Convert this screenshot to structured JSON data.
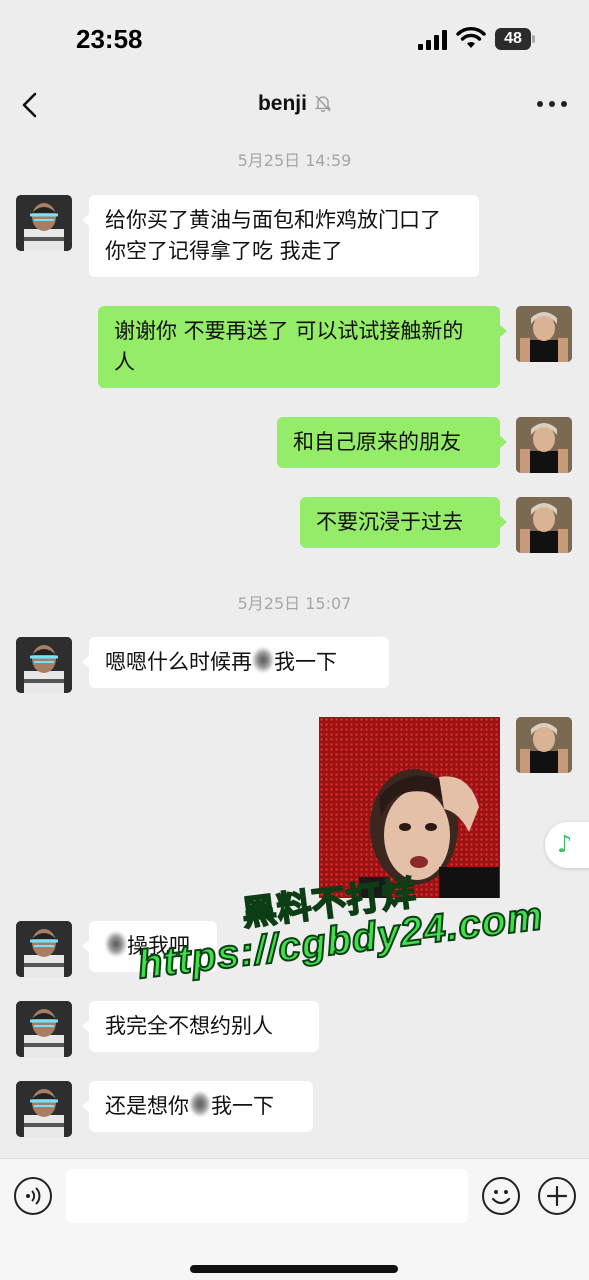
{
  "status_bar": {
    "time": "23:58",
    "battery": "48"
  },
  "header": {
    "title": "benji",
    "back_icon": "chevron-left-icon",
    "mute_icon": "bell-slash-icon",
    "more_icon": "ellipsis-icon"
  },
  "timestamps": [
    "5月25日 14:59",
    "5月25日 15:07"
  ],
  "messages": [
    {
      "side": "in",
      "text": "给你买了黄油与面包和炸鸡放门口了 你空了记得拿了吃 我走了"
    },
    {
      "side": "out",
      "text": "谢谢你 不要再送了 可以试试接触新的人"
    },
    {
      "side": "out",
      "text": "和自己原来的朋友"
    },
    {
      "side": "out",
      "text": "不要沉浸于过去"
    },
    {
      "side": "in",
      "text_before": "嗯嗯什么时候再",
      "text_after": "我一下"
    },
    {
      "side": "out",
      "type": "sticker"
    },
    {
      "side": "in",
      "text_after": "操我吧"
    },
    {
      "side": "in",
      "text": "我完全不想约别人"
    },
    {
      "side": "in",
      "text_before": "还是想你",
      "text_after": "我一下"
    }
  ],
  "watermark": {
    "line1": "黑料不打烊",
    "line2": "https://cgbdy24.com"
  },
  "input_bar": {
    "voice_icon": "voice-icon",
    "emoji_icon": "emoji-icon",
    "plus_icon": "plus-icon",
    "value": ""
  },
  "floating": {
    "music_icon": "music-note-icon",
    "music_glyph": "♪"
  },
  "colors": {
    "background": "#ededed",
    "incoming_bubble": "#ffffff",
    "outgoing_bubble": "#95ec69",
    "timestamp": "#a6a6a6",
    "watermark": "#3fe04a"
  }
}
